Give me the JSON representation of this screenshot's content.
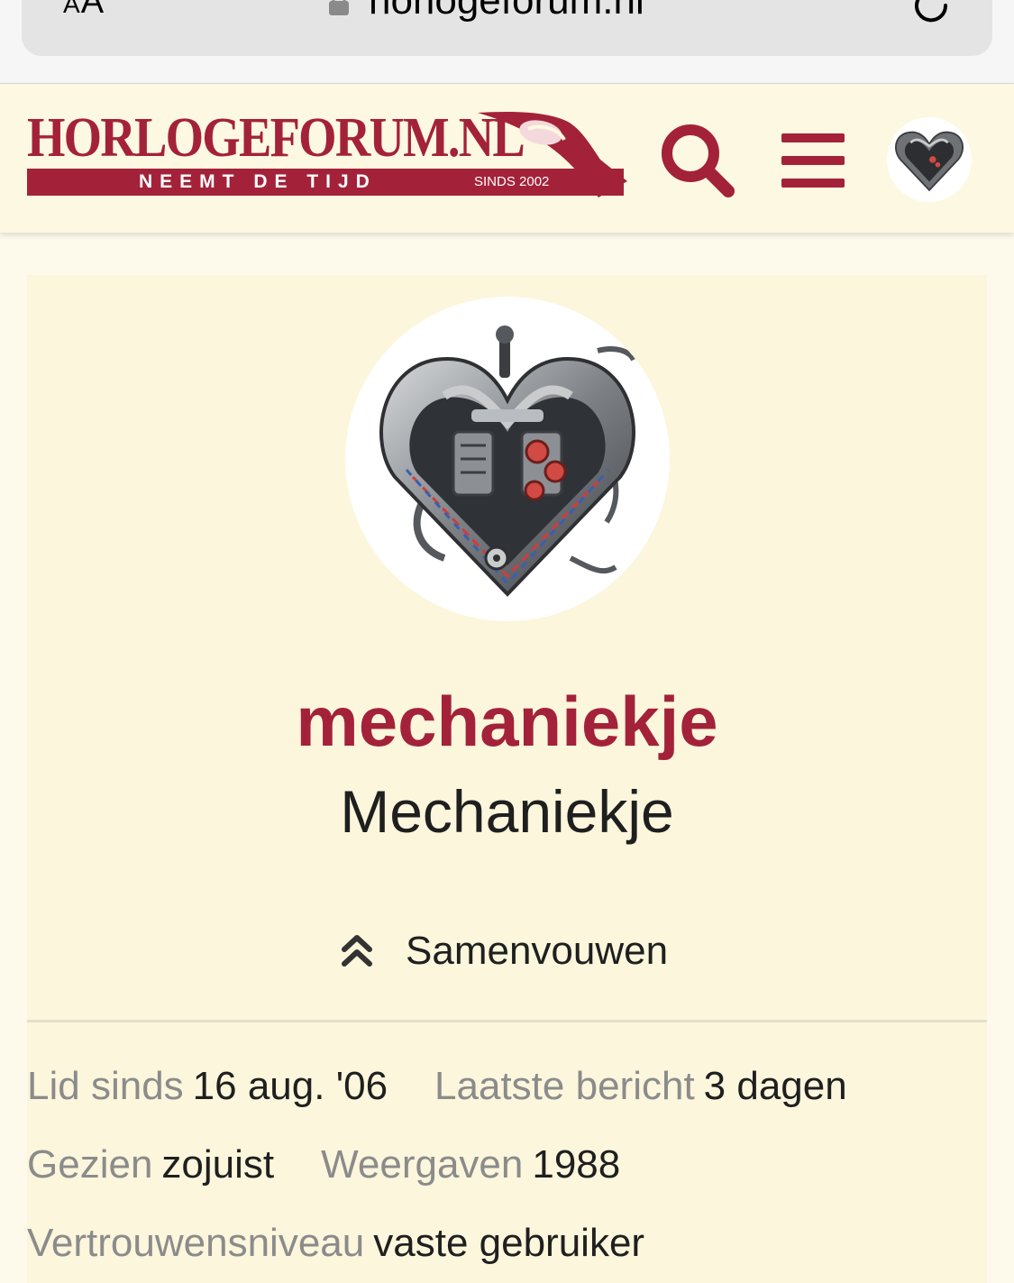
{
  "browser": {
    "text_size_label_small": "A",
    "text_size_label_large": "A",
    "url": "horlogeforum.nl"
  },
  "header": {
    "logo_title": "HORLOGEFORUM.NL",
    "logo_tagline": "NEEMT DE TIJD",
    "logo_since": "SINDS 2002",
    "icons": [
      "search-icon",
      "hamburger-menu-icon",
      "user-avatar"
    ],
    "accent_color": "#a3223a"
  },
  "profile": {
    "username": "mechaniekje",
    "display_name": "Mechaniekje",
    "collapse_label": "Samenvouwen",
    "stats": {
      "member_since_label": "Lid sinds",
      "member_since_value": "16 aug. '06",
      "last_post_label": "Laatste bericht",
      "last_post_value": "3 dagen",
      "seen_label": "Gezien",
      "seen_value": "zojuist",
      "views_label": "Weergaven",
      "views_value": "1988",
      "trust_label": "Vertrouwensniveau",
      "trust_value": "vaste gebruiker"
    }
  }
}
